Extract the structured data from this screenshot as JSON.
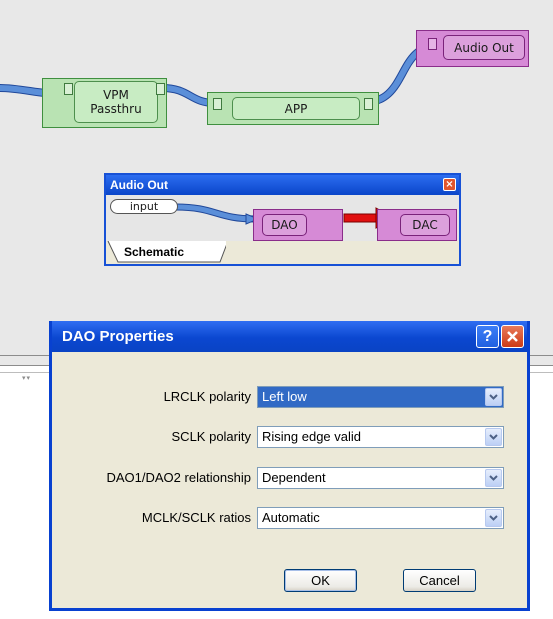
{
  "canvas": {
    "blocks": {
      "vpm": {
        "label_line1": "VPM",
        "label_line2": "Passthru"
      },
      "app": {
        "label": "APP"
      },
      "audio_out": {
        "label": "Audio Out"
      }
    }
  },
  "mini_window": {
    "title": "Audio Out",
    "input_label": "input",
    "dao_label": "DAO",
    "dac_label": "DAC",
    "tab_label": "Schematic"
  },
  "dialog": {
    "title": "DAO Properties",
    "help_label": "?",
    "rows": [
      {
        "label": "LRCLK polarity",
        "value": "Left low"
      },
      {
        "label": "SCLK polarity",
        "value": "Rising edge valid"
      },
      {
        "label": "DAO1/DAO2 relationship",
        "value": "Dependent"
      },
      {
        "label": "MCLK/SCLK ratios",
        "value": "Automatic"
      }
    ],
    "ok_label": "OK",
    "cancel_label": "Cancel"
  },
  "colors": {
    "block_green": "#b9e3b3",
    "block_magenta": "#d68ad6",
    "wire_blue": "#5b8fd9",
    "wire_red": "#e01010",
    "titlebar_blue": "#0b47d0",
    "selection_blue": "#316ac5"
  }
}
